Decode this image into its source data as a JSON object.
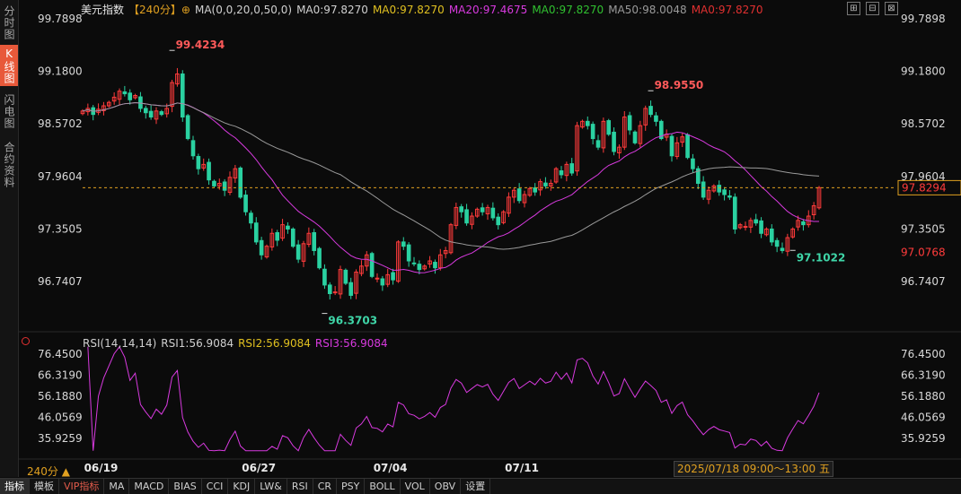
{
  "left_rail": [
    "分时图",
    "K线图",
    "闪电图",
    "合约资料"
  ],
  "legend": {
    "title": "美元指数",
    "period": "【240分】",
    "ma_params": "MA(0,0,20,0,50,0)",
    "ma0_a": "MA0:97.8270",
    "ma0_b": "MA0:97.8270",
    "ma20": "MA20:97.4675",
    "ma0_c": "MA0:97.8270",
    "ma50": "MA50:98.0048",
    "ma0_d": "MA0:97.8270"
  },
  "rsi_legend": {
    "params": "RSI(14,14,14)",
    "rsi1": "RSI1:56.9084",
    "rsi2": "RSI2:56.9084",
    "rsi3": "RSI3:56.9084"
  },
  "period_label": "240分 ▲",
  "date_tip": "2025/07/18 09:00～13:00 五",
  "bottom_tabs": [
    "指标",
    "模板",
    "VIP指标",
    "MA",
    "MACD",
    "BIAS",
    "CCI",
    "KDJ",
    "LW&",
    "RSI",
    "CR",
    "PSY",
    "BOLL",
    "VOL",
    "OBV",
    "设置"
  ],
  "colors": {
    "up": "#ff3b3b",
    "down": "#2ad1a1",
    "ma20": "#d83adf",
    "ma50": "#9a9a9a",
    "rsi": "#d83adf",
    "price_line": "#e0a020"
  },
  "chart_data": {
    "type": "candlestick",
    "price_axis": {
      "ticks": [
        "99.7898",
        "99.1800",
        "98.5702",
        "97.9604",
        "97.3505",
        "96.7407"
      ],
      "range": [
        96.37,
        99.79
      ]
    },
    "x_axis": {
      "ticks": [
        "06/19",
        "06/27",
        "07/04",
        "07/11"
      ],
      "tick_index": [
        3,
        33,
        58,
        83
      ]
    },
    "last_price": "97.8294",
    "last_price_value": 97.8294,
    "other_price_label": "97.0768",
    "annotations": [
      {
        "text": "99.4234",
        "value": 99.4234,
        "index": 17
      },
      {
        "text": "96.3703",
        "value": 96.3703,
        "index": 46
      },
      {
        "text": "98.9550",
        "value": 98.955,
        "index": 108
      },
      {
        "text": "97.1022",
        "value": 97.1022,
        "index": 135
      }
    ],
    "closes": [
      98.72,
      98.75,
      98.68,
      98.74,
      98.78,
      98.82,
      98.88,
      98.95,
      98.92,
      98.85,
      98.9,
      98.75,
      98.7,
      98.65,
      98.72,
      98.68,
      98.75,
      99.05,
      99.15,
      98.65,
      98.4,
      98.2,
      98.05,
      98.1,
      97.92,
      97.85,
      97.88,
      97.8,
      97.95,
      98.05,
      97.72,
      97.55,
      97.42,
      97.2,
      97.05,
      97.15,
      97.3,
      97.22,
      97.4,
      97.35,
      97.15,
      97.0,
      97.18,
      97.3,
      97.1,
      96.9,
      96.7,
      96.6,
      96.62,
      96.88,
      96.72,
      96.58,
      96.85,
      96.92,
      97.05,
      96.8,
      96.78,
      96.7,
      96.82,
      96.76,
      97.2,
      97.15,
      96.98,
      96.95,
      96.88,
      96.92,
      96.98,
      96.9,
      97.05,
      97.1,
      97.4,
      97.6,
      97.55,
      97.42,
      97.5,
      97.58,
      97.55,
      97.6,
      97.48,
      97.4,
      97.55,
      97.72,
      97.8,
      97.68,
      97.75,
      97.82,
      97.78,
      97.9,
      97.85,
      97.88,
      98.05,
      97.98,
      98.1,
      98.0,
      98.55,
      98.6,
      98.55,
      98.4,
      98.3,
      98.6,
      98.45,
      98.25,
      98.3,
      98.65,
      98.5,
      98.35,
      98.55,
      98.75,
      98.68,
      98.6,
      98.4,
      98.45,
      98.2,
      98.35,
      98.42,
      98.18,
      98.05,
      97.88,
      97.72,
      97.8,
      97.85,
      97.78,
      97.75,
      97.72,
      97.35,
      97.4,
      97.38,
      97.45,
      97.42,
      97.3,
      97.35,
      97.2,
      97.15,
      97.1,
      97.25,
      97.35,
      97.45,
      97.4,
      97.5,
      97.62,
      97.83
    ]
  }
}
